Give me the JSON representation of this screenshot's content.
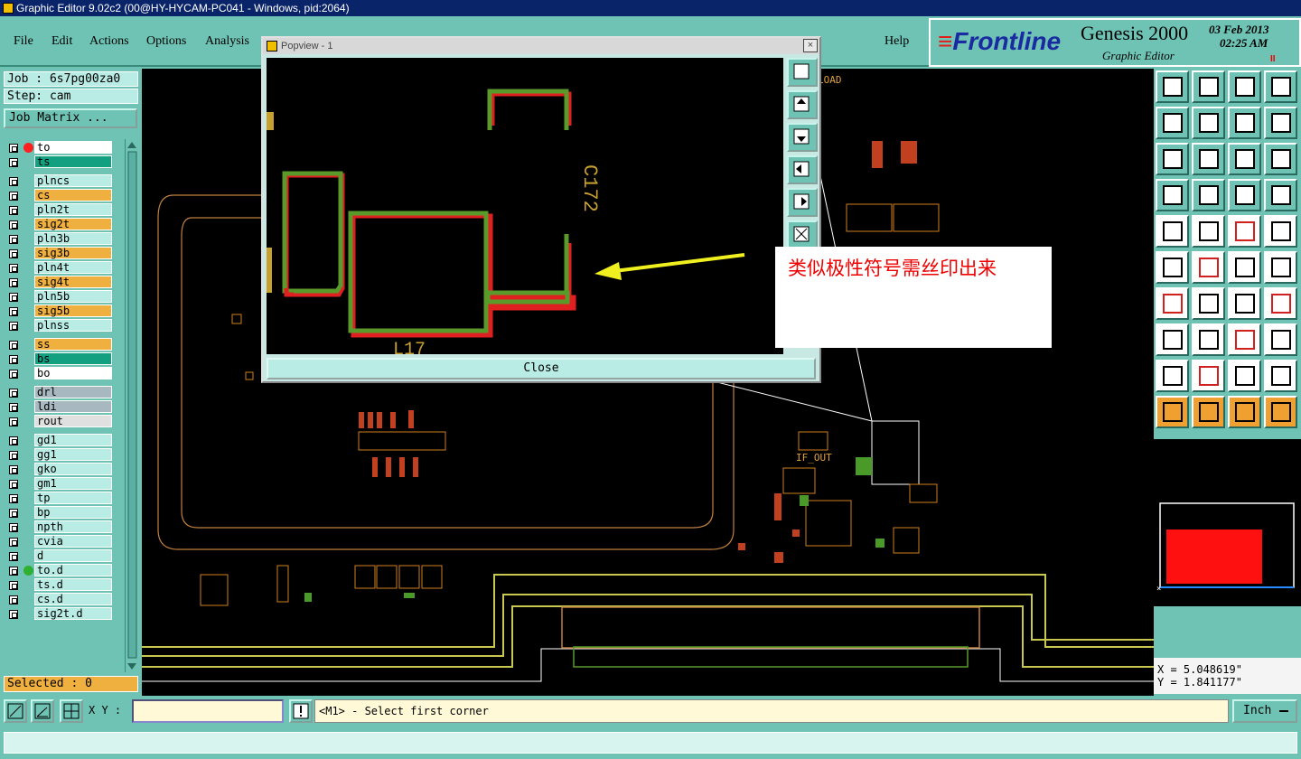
{
  "window": {
    "title": "Graphic Editor 9.02c2 (00@HY-HYCAM-PC041 - Windows, pid:2064)"
  },
  "menu": {
    "file": "File",
    "edit": "Edit",
    "actions": "Actions",
    "options": "Options",
    "analysis": "Analysis",
    "help": "Help"
  },
  "brand": {
    "logo": "Frontline",
    "product": "Genesis 2000",
    "module": "Graphic Editor",
    "date": "03 Feb 2013",
    "time": "02:25 AM",
    "pause": "II"
  },
  "info": {
    "job": "Job : 6s7pg00za0",
    "step": "Step: cam",
    "job_matrix": "Job Matrix ..."
  },
  "layers": [
    {
      "name": "to",
      "color": "#ffffff",
      "dot": "#ff2020"
    },
    {
      "name": "ts",
      "color": "#12a080",
      "dot": ""
    },
    {
      "name": "plncs",
      "color": "#b8ece4",
      "dot": ""
    },
    {
      "name": "cs",
      "color": "#f0b040",
      "dot": ""
    },
    {
      "name": "pln2t",
      "color": "#b8ece4",
      "dot": ""
    },
    {
      "name": "sig2t",
      "color": "#f0b040",
      "dot": ""
    },
    {
      "name": "pln3b",
      "color": "#b8ece4",
      "dot": ""
    },
    {
      "name": "sig3b",
      "color": "#f0b040",
      "dot": ""
    },
    {
      "name": "pln4t",
      "color": "#b8ece4",
      "dot": ""
    },
    {
      "name": "sig4t",
      "color": "#f0b040",
      "dot": ""
    },
    {
      "name": "pln5b",
      "color": "#b8ece4",
      "dot": ""
    },
    {
      "name": "sig5b",
      "color": "#f0b040",
      "dot": ""
    },
    {
      "name": "plnss",
      "color": "#b8ece4",
      "dot": ""
    },
    {
      "name": "ss",
      "color": "#f0b040",
      "dot": ""
    },
    {
      "name": "bs",
      "color": "#12a080",
      "dot": ""
    },
    {
      "name": "bo",
      "color": "#ffffff",
      "dot": ""
    },
    {
      "name": "drl",
      "color": "#a8b8c0",
      "dot": ""
    },
    {
      "name": "ldi",
      "color": "#a8b8c0",
      "dot": ""
    },
    {
      "name": "rout",
      "color": "#e0e0e0",
      "dot": ""
    },
    {
      "name": "gd1",
      "color": "#b8ece4",
      "dot": ""
    },
    {
      "name": "gg1",
      "color": "#b8ece4",
      "dot": ""
    },
    {
      "name": "gko",
      "color": "#b8ece4",
      "dot": ""
    },
    {
      "name": "gm1",
      "color": "#b8ece4",
      "dot": ""
    },
    {
      "name": "tp",
      "color": "#b8ece4",
      "dot": ""
    },
    {
      "name": "bp",
      "color": "#b8ece4",
      "dot": ""
    },
    {
      "name": "npth",
      "color": "#b8ece4",
      "dot": ""
    },
    {
      "name": "cvia",
      "color": "#b8ece4",
      "dot": ""
    },
    {
      "name": "d",
      "color": "#b8ece4",
      "dot": ""
    },
    {
      "name": "to.d",
      "color": "#b8ece4",
      "dot": "#30b030"
    },
    {
      "name": "ts.d",
      "color": "#b8ece4",
      "dot": ""
    },
    {
      "name": "cs.d",
      "color": "#b8ece4",
      "dot": ""
    },
    {
      "name": "sig2t.d",
      "color": "#b8ece4",
      "dot": ""
    }
  ],
  "selected": "Selected : 0",
  "popup": {
    "title": "Popview - 1",
    "close_label": "Close",
    "refdes_c": "C172",
    "refdes_l": "L17"
  },
  "annotation": {
    "text": "类似极性符号需丝印出来"
  },
  "board_labels": {
    "load": "LOAD",
    "if_out": "IF_OUT"
  },
  "coords": {
    "x": "X = 5.048619\"",
    "y": "Y = 1.841177\""
  },
  "bottom": {
    "xy_label": "X Y :",
    "xy_value": "",
    "hint": "<M1> - Select first corner",
    "units": "Inch"
  },
  "colors": {
    "panel": "#6ec3b4",
    "layer_orange": "#f0b040",
    "trace_yellow": "#c8c850",
    "silk_orange": "#d08020",
    "pad_green": "#5a9a2a",
    "pad_red": "#e02020",
    "arrow_yellow": "#f0f020"
  }
}
